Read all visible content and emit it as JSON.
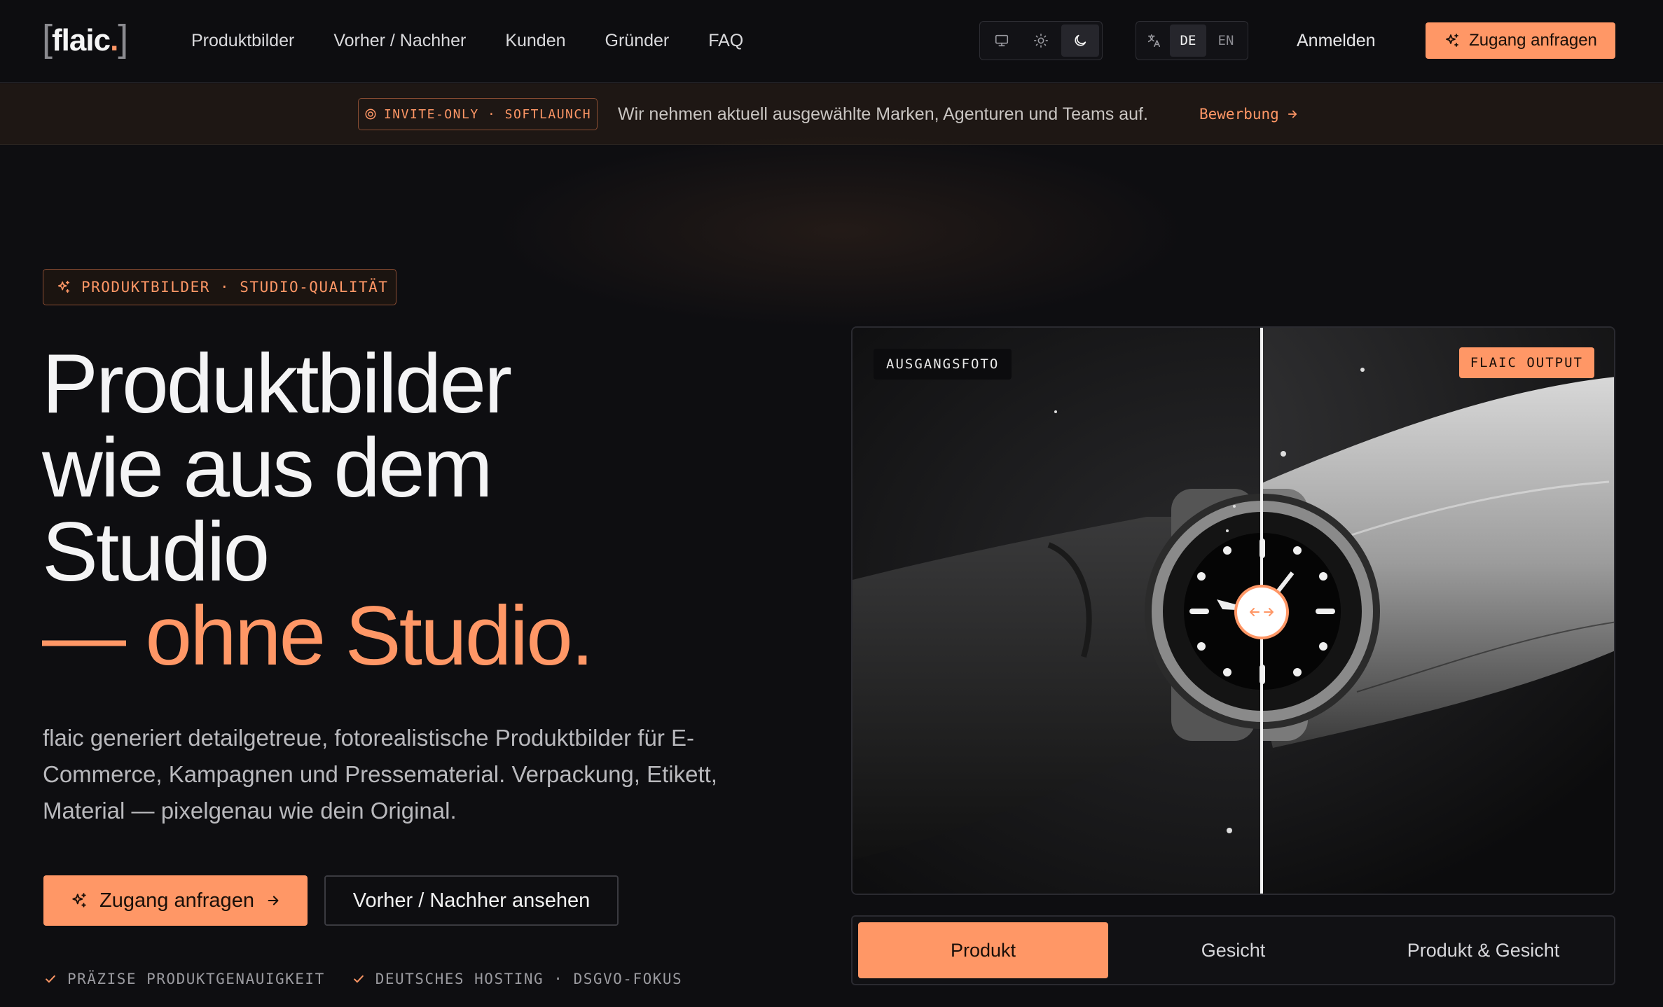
{
  "brand": {
    "logo_text": "flaic",
    "logo_dot": ".",
    "accent_color": "#ff9766",
    "background_color": "#0e0e11"
  },
  "nav": {
    "links": [
      "Produktbilder",
      "Vorher / Nachher",
      "Kunden",
      "Gründer",
      "FAQ"
    ],
    "theme_options": [
      {
        "icon": "monitor-icon",
        "active": false
      },
      {
        "icon": "sun-icon",
        "active": false
      },
      {
        "icon": "moon-icon",
        "active": true
      }
    ],
    "language_icon": "translate-icon",
    "languages": [
      {
        "label": "DE",
        "active": true
      },
      {
        "label": "EN",
        "active": false
      }
    ],
    "login_label": "Anmelden",
    "cta_label": "Zugang anfragen",
    "cta_icon": "sparkle-icon"
  },
  "announcement": {
    "badge": "INVITE-ONLY · SOFTLAUNCH",
    "badge_icon": "target-icon",
    "text": "Wir nehmen aktuell ausgewählte Marken, Agenturen und Teams auf.",
    "link_label": "Bewerbung",
    "link_icon": "arrow-right-icon"
  },
  "hero": {
    "eyebrow": "PRODUKTBILDER · STUDIO-QUALITÄT",
    "eyebrow_icon": "sparkle-icon",
    "headline_lines": [
      "Produktbilder",
      "wie aus dem",
      "Studio"
    ],
    "headline_accent": "— ohne Studio.",
    "lede": "flaic generiert detailgetreue, fotorealistische Produktbilder für E-Commerce, Kampagnen und Pressematerial. Verpackung, Etikett, Material — pixelgenau wie dein Original.",
    "primary_cta": "Zugang anfragen",
    "secondary_cta": "Vorher / Nachher ansehen",
    "features": [
      "PRÄZISE PRODUKTGENAUIGKEIT",
      "DEUTSCHES HOSTING · DSGVO-FOKUS"
    ],
    "feature_icon": "check-icon"
  },
  "compare": {
    "label_before": "AUSGANGSFOTO",
    "label_after": "FLAIC OUTPUT",
    "handle_icon": "arrows-horizontal-icon",
    "slider_position_percent": 53.5,
    "tabs": [
      {
        "label": "Produkt",
        "active": true
      },
      {
        "label": "Gesicht",
        "active": false
      },
      {
        "label": "Produkt & Gesicht",
        "active": false
      }
    ]
  }
}
